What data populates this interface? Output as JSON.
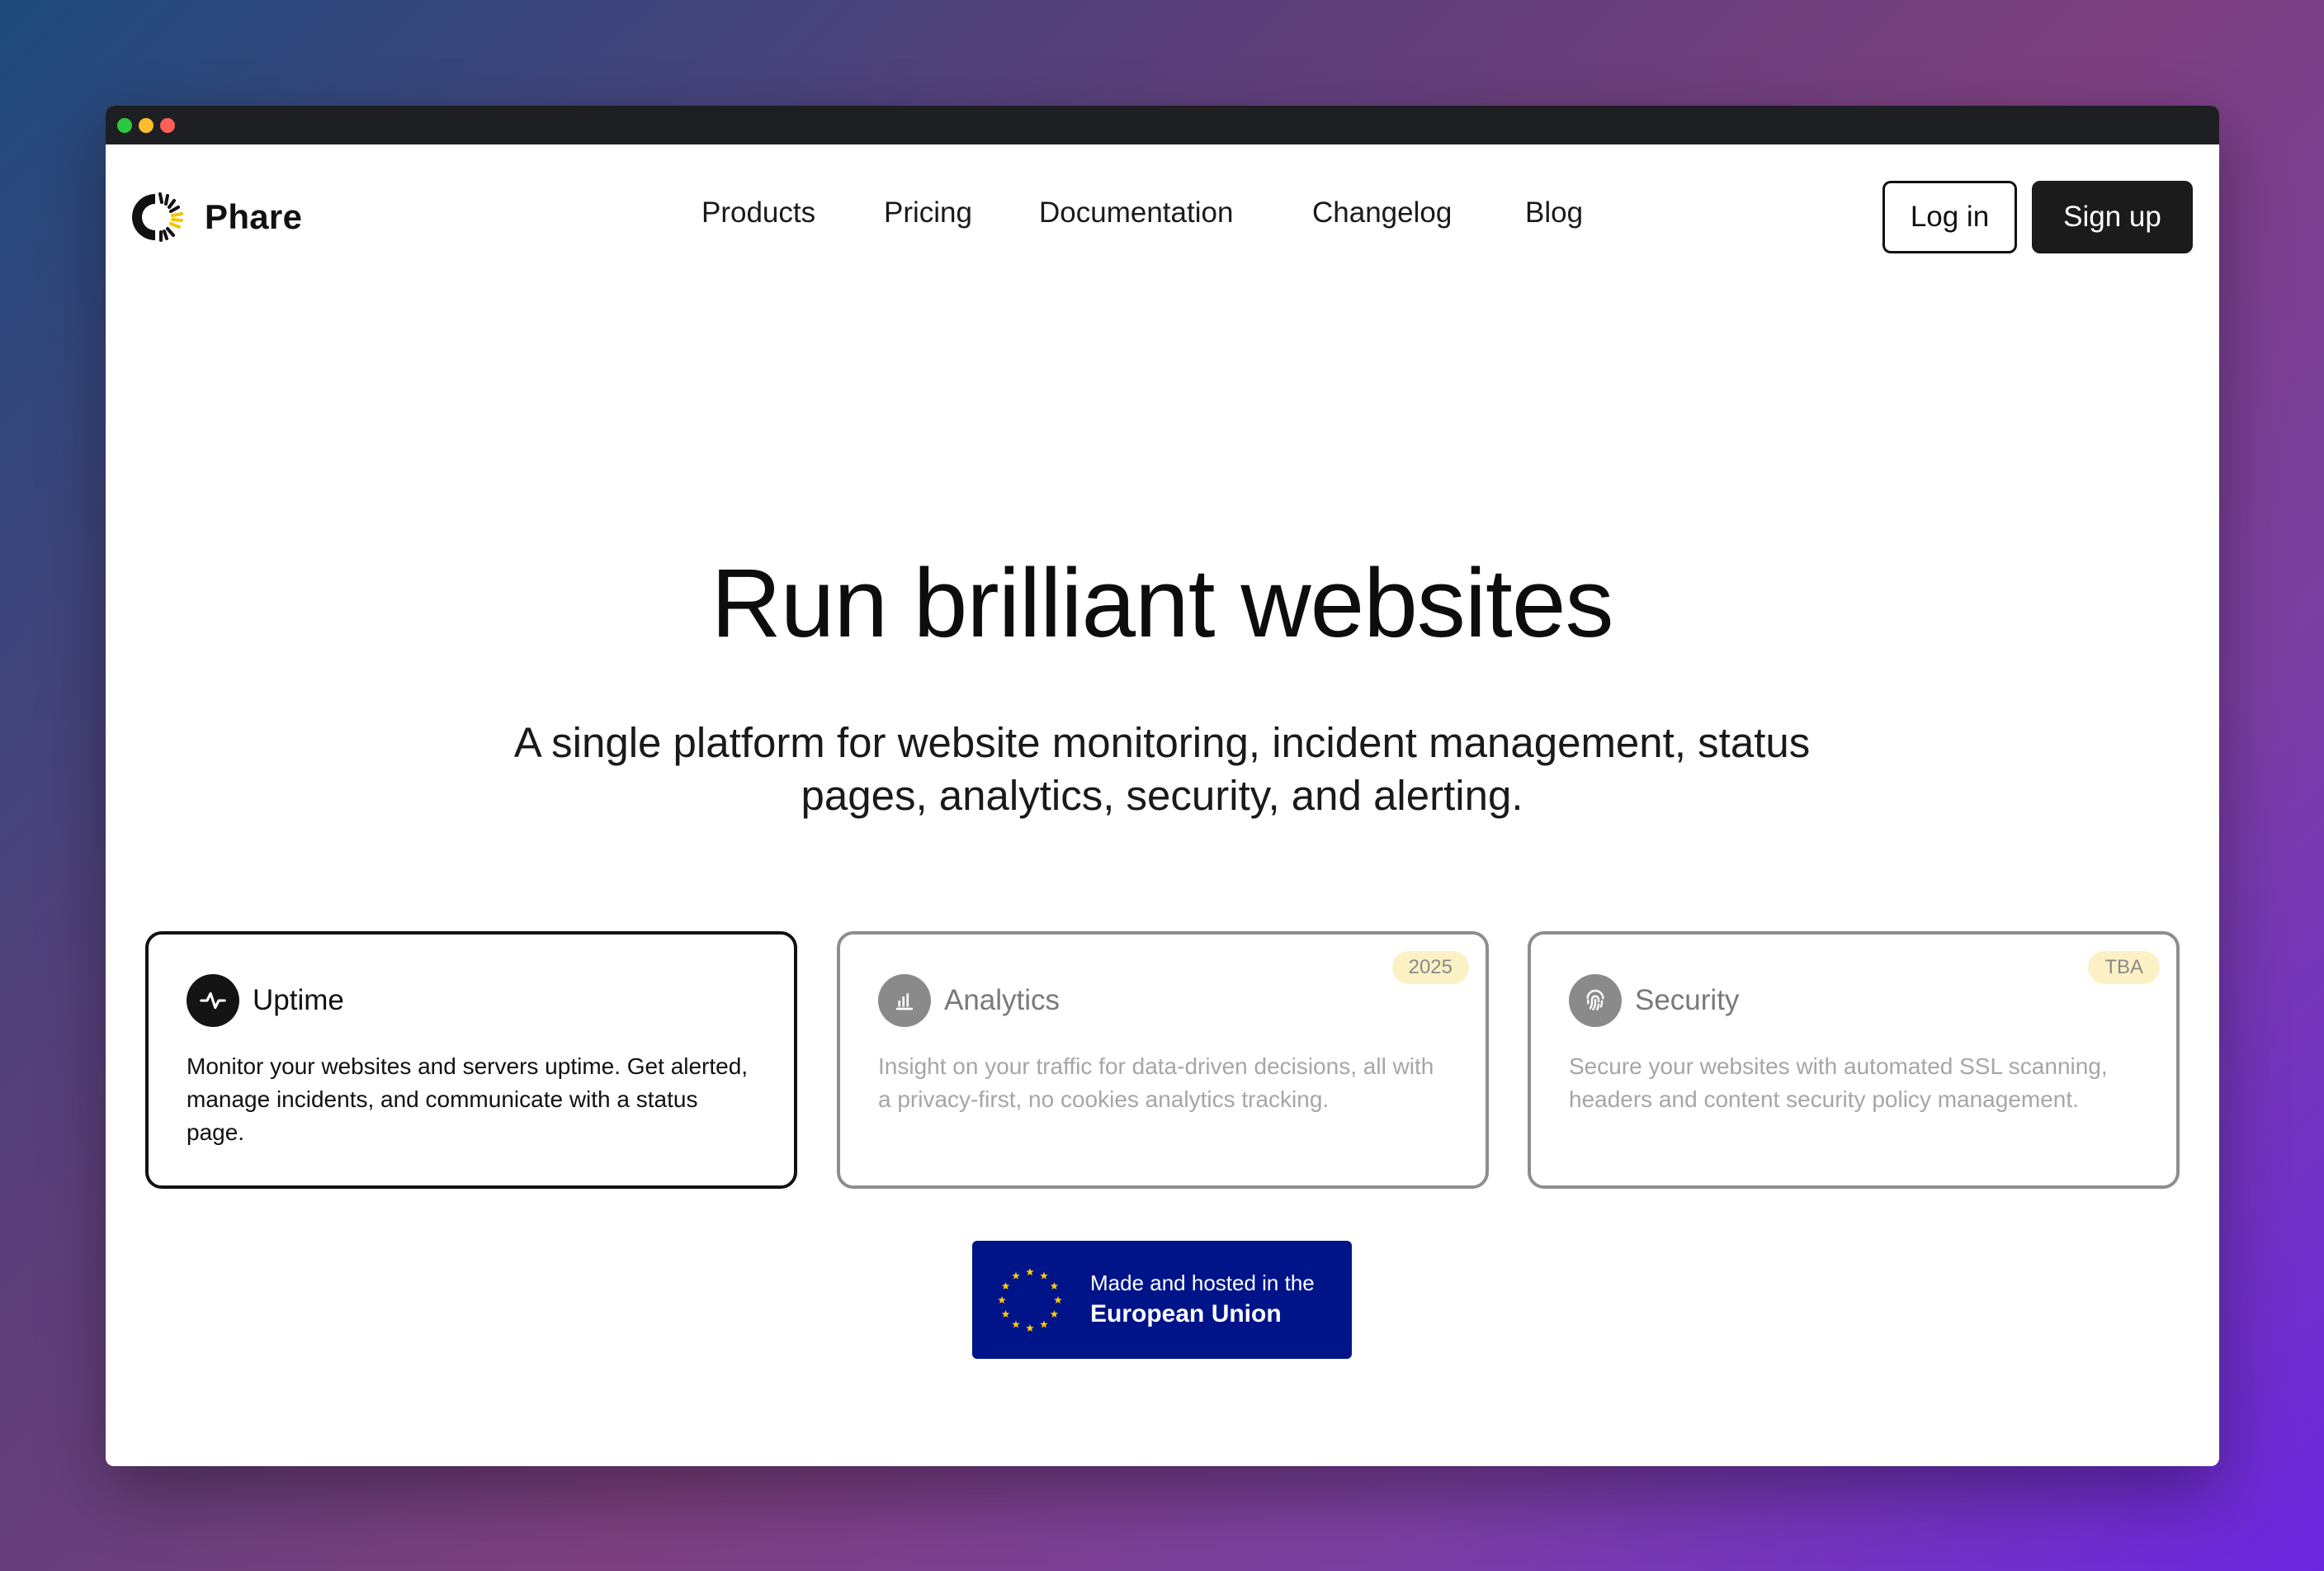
{
  "window": {
    "dots": [
      "green",
      "yellow",
      "red"
    ]
  },
  "brand": {
    "name": "Phare",
    "logo_icon": "phare-lighthouse-logo"
  },
  "nav": {
    "links": [
      "Products",
      "Pricing",
      "Documentation",
      "Changelog",
      "Blog"
    ],
    "login_label": "Log in",
    "signup_label": "Sign up"
  },
  "hero": {
    "title": "Run brilliant websites",
    "subtitle": "A single platform for website monitoring, incident management, status pages, analytics, security, and alerting."
  },
  "cards": [
    {
      "title": "Uptime",
      "icon": "pulse-icon",
      "state": "active",
      "badge": "",
      "body": "Monitor your websites and servers uptime. Get alerted, manage incidents, and communicate with a status page."
    },
    {
      "title": "Analytics",
      "icon": "bar-chart-icon",
      "state": "muted",
      "badge": "2025",
      "body": "Insight on your traffic for data-driven decisions, all with a privacy-first, no cookies analytics tracking."
    },
    {
      "title": "Security",
      "icon": "fingerprint-icon",
      "state": "muted",
      "badge": "TBA",
      "body": "Secure your websites with automated SSL scanning, headers and content security policy management."
    }
  ],
  "eu_badge": {
    "line1": "Made and hosted in the",
    "line2": "European Union",
    "icon": "eu-stars-icon",
    "background": "#001489",
    "star_color": "#ffcc00"
  },
  "colors": {
    "accent_dark": "#1b1b1b",
    "muted_text": "#a6a6a6",
    "badge_bg": "#fbf1c4",
    "logo_accent": "#f5c400"
  }
}
